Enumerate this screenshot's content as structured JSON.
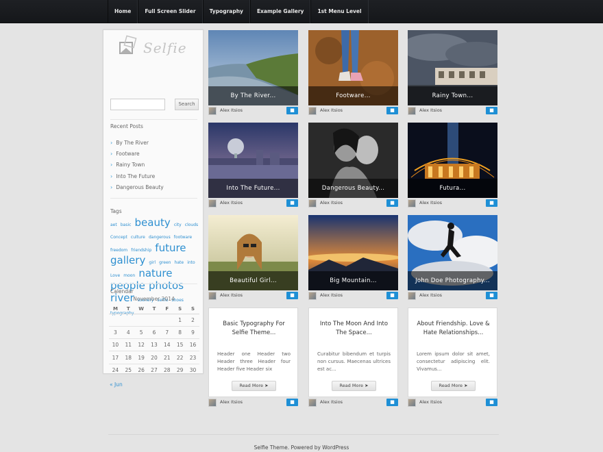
{
  "nav": [
    "Home",
    "Full Screen Slider",
    "Typography",
    "Example Gallery",
    "1st Menu Level"
  ],
  "logo": {
    "text": "Selfie"
  },
  "search": {
    "placeholder": "",
    "button": "Search"
  },
  "recent_posts": {
    "title": "Recent Posts",
    "items": [
      "By The River",
      "Footware",
      "Rainy Town",
      "Into The Future",
      "Dangerous Beauty"
    ]
  },
  "tags": {
    "title": "Tags",
    "items": [
      {
        "label": "aet",
        "size": 6
      },
      {
        "label": "basic",
        "size": 6
      },
      {
        "label": "beauty",
        "size": 15
      },
      {
        "label": "city",
        "size": 6
      },
      {
        "label": "clouds",
        "size": 6
      },
      {
        "label": "Concept",
        "size": 6
      },
      {
        "label": "culture",
        "size": 6
      },
      {
        "label": "dangerous",
        "size": 6
      },
      {
        "label": "footware",
        "size": 6
      },
      {
        "label": "freedom",
        "size": 6
      },
      {
        "label": "friendship",
        "size": 6
      },
      {
        "label": "future",
        "size": 15
      },
      {
        "label": "gallery",
        "size": 15
      },
      {
        "label": "girl",
        "size": 6
      },
      {
        "label": "green",
        "size": 6
      },
      {
        "label": "hate",
        "size": 6
      },
      {
        "label": "into",
        "size": 6
      },
      {
        "label": "Love",
        "size": 6
      },
      {
        "label": "moon",
        "size": 6
      },
      {
        "label": "nature",
        "size": 15
      },
      {
        "label": "people",
        "size": 15
      },
      {
        "label": "photos",
        "size": 15
      },
      {
        "label": "river",
        "size": 15
      },
      {
        "label": "scenery",
        "size": 6
      },
      {
        "label": "selfie",
        "size": 6
      },
      {
        "label": "shoes",
        "size": 6
      },
      {
        "label": "typography",
        "size": 6
      }
    ]
  },
  "calendar": {
    "title": "Calendar",
    "caption": "November 2014",
    "days": [
      "M",
      "T",
      "W",
      "T",
      "F",
      "S",
      "S"
    ],
    "weeks": [
      [
        "",
        "",
        "",
        "",
        "",
        "1",
        "2"
      ],
      [
        "3",
        "4",
        "5",
        "6",
        "7",
        "8",
        "9"
      ],
      [
        "10",
        "11",
        "12",
        "13",
        "14",
        "15",
        "16"
      ],
      [
        "17",
        "18",
        "19",
        "20",
        "21",
        "22",
        "23"
      ],
      [
        "24",
        "25",
        "26",
        "27",
        "28",
        "29",
        "30"
      ]
    ],
    "prev": "« Jun"
  },
  "photo_posts": [
    {
      "label": "By The River...",
      "author": "Alex Itsios",
      "scene": "river"
    },
    {
      "label": "Footware...",
      "author": "Alex Itsios",
      "scene": "footware"
    },
    {
      "label": "Rainy Town...",
      "author": "Alex Itsios",
      "scene": "rainy"
    },
    {
      "label": "Into The Future...",
      "author": "Alex Itsios",
      "scene": "future"
    },
    {
      "label": "Dangerous Beauty...",
      "author": "Alex Itsios",
      "scene": "beauty"
    },
    {
      "label": "Futura...",
      "author": "Alex Itsios",
      "scene": "futura"
    },
    {
      "label": "Beautiful Girl...",
      "author": "Alex Itsios",
      "scene": "girl"
    },
    {
      "label": "Big Mountain...",
      "author": "Alex Itsios",
      "scene": "mountain"
    },
    {
      "label": "John Doe Photography...",
      "author": "Alex Itsios",
      "scene": "jump"
    }
  ],
  "text_posts": [
    {
      "title": "Basic Typography For Selfie Theme...",
      "excerpt": "Header one Header two Header three Header four Header five Header six",
      "button": "Read More",
      "author": "Alex Itsios"
    },
    {
      "title": "Into The Moon And Into The Space...",
      "excerpt": "Curabitur bibendum et turpis non cursus. Maecenas ultrices est ac...",
      "button": "Read More",
      "author": "Alex Itsios"
    },
    {
      "title": "About Friendship. Love & Hate Relationships...",
      "excerpt": "Lorem ipsum dolor sit amet, consectetur adipiscing elit. Vivamus...",
      "button": "Read More",
      "author": "Alex Itsios"
    }
  ],
  "footer": "Selfie Theme. Powered by WordPress"
}
